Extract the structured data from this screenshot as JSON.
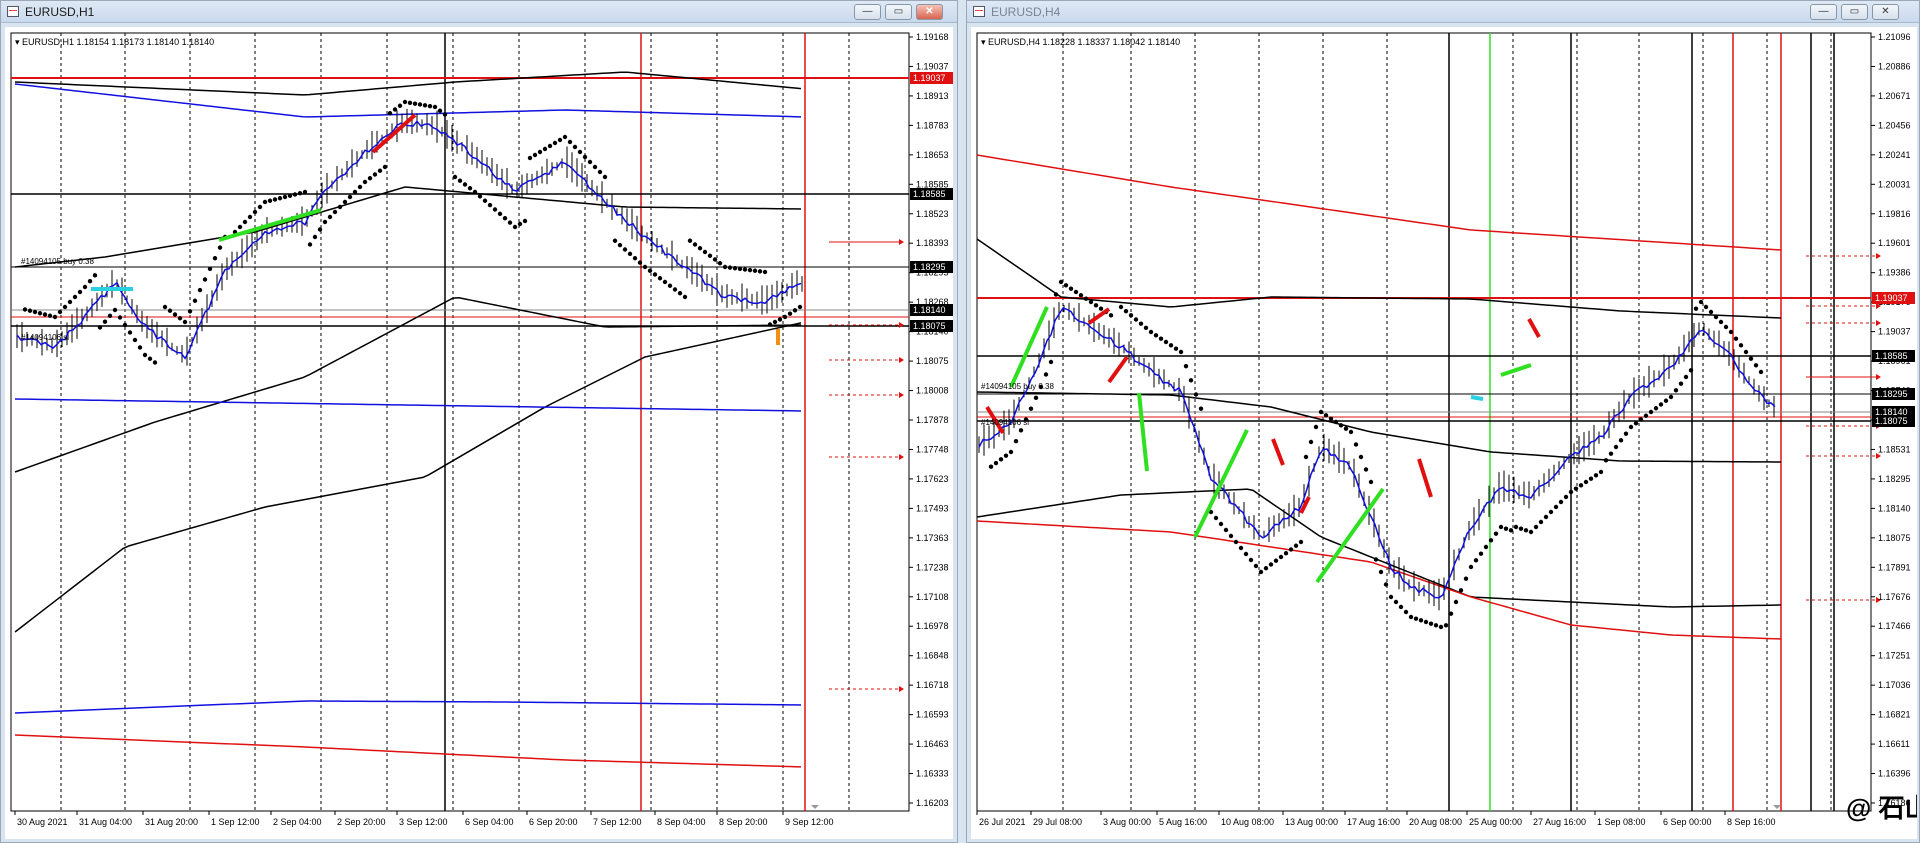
{
  "window1": {
    "title": "EURUSD,H1",
    "buttons": {
      "minimize": "—",
      "restore": "▭",
      "close": "✕"
    },
    "chart": {
      "info": "EURUSD,H1  1.18154 1.18173 1.18140 1.18140",
      "order1_label": "#14094105 buy 0.38",
      "order2_label": "#14094106 sl",
      "y_ticks": [
        "1.19168",
        "1.19037",
        "1.18913",
        "1.18783",
        "1.18653",
        "1.18585",
        "1.18523",
        "1.18393",
        "1.18295",
        "1.18268",
        "1.18140",
        "1.18075",
        "1.18008",
        "1.17878",
        "1.17748",
        "1.17623",
        "1.17493",
        "1.17363",
        "1.17238",
        "1.17108",
        "1.16978",
        "1.16848",
        "1.16718",
        "1.16593",
        "1.16463",
        "1.16333",
        "1.16203"
      ],
      "highlight_labels": [
        {
          "text": "1.19037",
          "style": "red"
        },
        {
          "text": "1.18585",
          "style": "black"
        },
        {
          "text": "1.18295",
          "style": "black"
        },
        {
          "text": "1.18140",
          "style": "black"
        },
        {
          "text": "1.18075",
          "style": "black"
        }
      ],
      "x_ticks": [
        "30 Aug 2021",
        "31 Aug 04:00",
        "31 Aug 20:00",
        "1 Sep 12:00",
        "2 Sep 04:00",
        "2 Sep 20:00",
        "3 Sep 12:00",
        "6 Sep 04:00",
        "6 Sep 20:00",
        "7 Sep 12:00",
        "8 Sep 04:00",
        "8 Sep 20:00",
        "9 Sep 12:00"
      ]
    }
  },
  "window2": {
    "title": "EURUSD,H4",
    "buttons": {
      "minimize": "—",
      "restore": "▭",
      "close": "✕"
    },
    "chart": {
      "info": "EURUSD,H4  1.18228 1.18337 1.18042 1.18140",
      "order1_label": "#14094105 buy 0.38",
      "order2_label": "#14094106 sl",
      "y_ticks": [
        "1.21096",
        "1.20886",
        "1.20671",
        "1.20456",
        "1.20241",
        "1.20031",
        "1.19816",
        "1.19601",
        "1.19386",
        "1.19176",
        "1.19037",
        "1.18961",
        "1.18746",
        "1.18585",
        "1.18531",
        "1.18295",
        "1.18140",
        "1.18075",
        "1.17891",
        "1.17676",
        "1.17466",
        "1.17251",
        "1.17036",
        "1.16821",
        "1.16611",
        "1.16396",
        "1.16186"
      ],
      "highlight_labels": [
        {
          "text": "1.19037",
          "style": "red"
        },
        {
          "text": "1.18585",
          "style": "black"
        },
        {
          "text": "1.18295",
          "style": "black"
        },
        {
          "text": "1.18140",
          "style": "black"
        },
        {
          "text": "1.18075",
          "style": "black"
        }
      ],
      "x_ticks": [
        "26 Jul 2021",
        "29 Jul 08:00",
        "3 Aug 00:00",
        "5 Aug 16:00",
        "10 Aug 08:00",
        "13 Aug 00:00",
        "17 Aug 16:00",
        "20 Aug 08:00",
        "25 Aug 00:00",
        "27 Aug 16:00",
        "1 Sep 08:00",
        "6 Sep 00:00",
        "8 Sep 16:00"
      ],
      "watermark": "@ 石山"
    }
  }
}
